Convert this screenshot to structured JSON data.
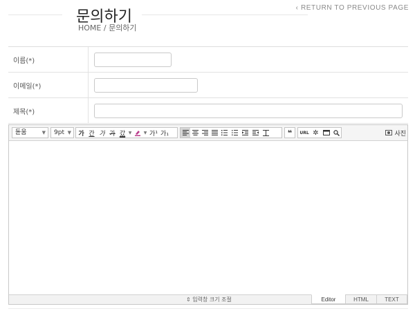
{
  "header": {
    "title": "문의하기",
    "breadcrumb": "HOME / 문의하기",
    "back_link": "‹ RETURN TO PREVIOUS PAGE"
  },
  "form": {
    "rows": [
      {
        "label": "이름(*)",
        "value": ""
      },
      {
        "label": "이메일(*)",
        "value": ""
      },
      {
        "label": "제목(*)",
        "value": ""
      }
    ]
  },
  "editor": {
    "font_select": "돋움",
    "size_select": "9pt",
    "format_buttons": [
      "가",
      "간",
      "가",
      "가",
      "갔"
    ],
    "color_buttons": [
      "가",
      "가¹",
      "가₁"
    ],
    "url_label": "URL",
    "photo_label": "사진",
    "resize_label": "⇕ 입력창 크기 조절",
    "modes": [
      "Editor",
      "HTML",
      "TEXT"
    ],
    "active_mode": "Editor"
  },
  "colors": {
    "border": "#dedede",
    "toolbar_bg": "#f5f5f5",
    "title": "#222222"
  }
}
